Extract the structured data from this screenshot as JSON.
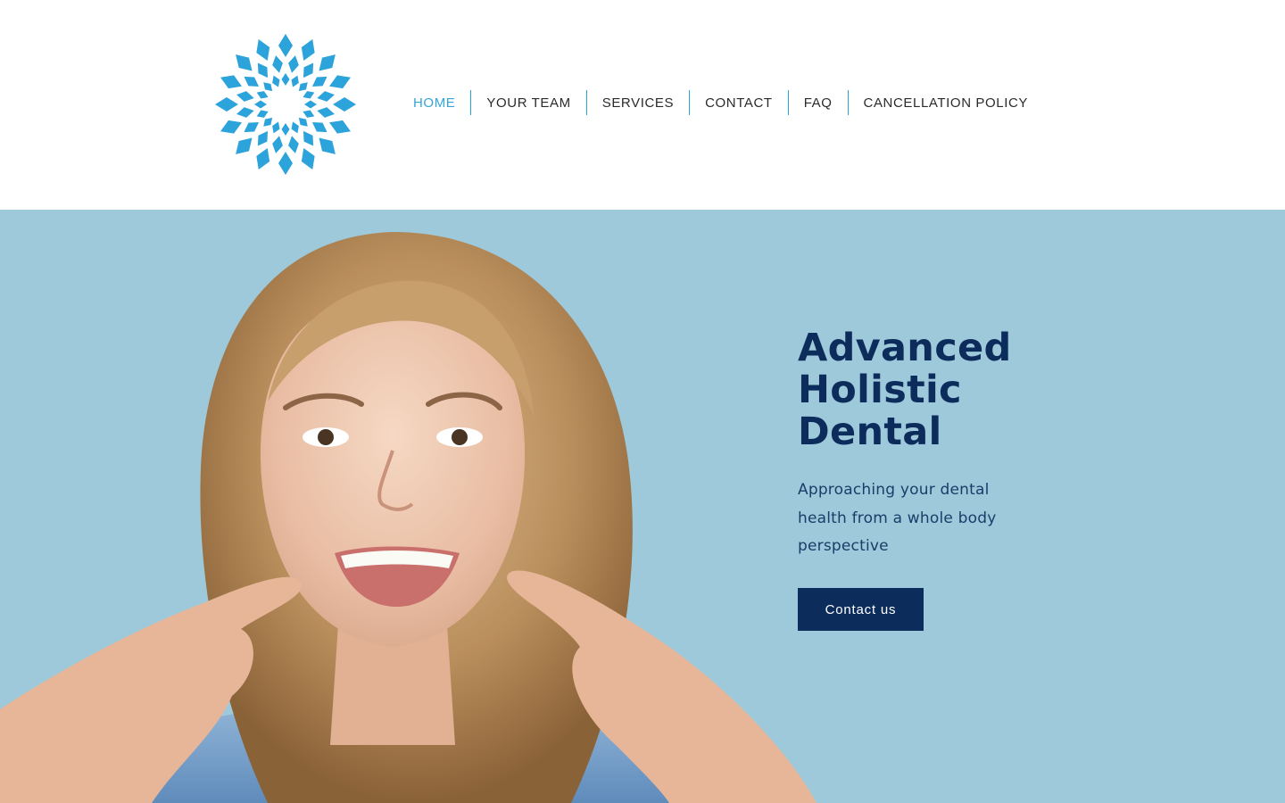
{
  "brand": {
    "logo_icon": "starburst-logo-icon",
    "accent_color": "#2aa3d8"
  },
  "nav": {
    "items": [
      {
        "label": "HOME",
        "active": true
      },
      {
        "label": "YOUR TEAM",
        "active": false
      },
      {
        "label": "SERVICES",
        "active": false
      },
      {
        "label": "CONTACT",
        "active": false
      },
      {
        "label": "FAQ",
        "active": false
      },
      {
        "label": "CANCELLATION POLICY",
        "active": false
      }
    ],
    "active_color": "#35a4d6",
    "text_color": "#2b2b2b",
    "divider_color": "#2aa3d8"
  },
  "hero": {
    "title_line1": "Advanced",
    "title_line2": "Holistic",
    "title_line3": "Dental",
    "subtitle": "Approaching your dental health from a whole body perspective",
    "cta_label": "Contact us",
    "background_color": "#9ec9da",
    "title_color": "#0c2c5c",
    "button_color": "#0c2c5c",
    "photo": "smiling-woman-pointing-at-smile-photo"
  }
}
